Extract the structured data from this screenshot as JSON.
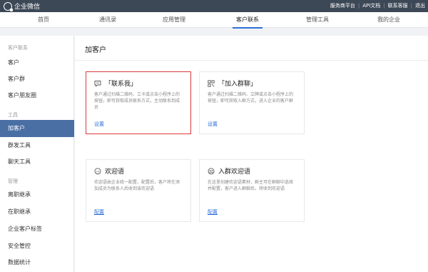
{
  "topbar": {
    "app_name": "企业微信",
    "links": [
      "服务商平台",
      "API文档",
      "联系客服",
      "退出"
    ]
  },
  "nav": {
    "items": [
      {
        "label": "首页"
      },
      {
        "label": "通讯录"
      },
      {
        "label": "应用管理"
      },
      {
        "label": "客户联系",
        "active": true
      },
      {
        "label": "管理工具"
      },
      {
        "label": "我的企业"
      }
    ]
  },
  "sidebar": {
    "groups": [
      {
        "label": "客户联系",
        "items": [
          "客户",
          "客户群",
          "客户朋友圈"
        ]
      },
      {
        "label": "工具",
        "items": [
          "加客户",
          "群发工具",
          "聊天工具"
        ]
      },
      {
        "label": "管理",
        "items": [
          "离职继承",
          "在职继承",
          "企业客户标签",
          "安全管控",
          "数据统计"
        ]
      }
    ],
    "active_item": "加客户"
  },
  "main": {
    "title": "加客户",
    "cards": [
      {
        "icon": "chat-bubble-icon",
        "title": "「联系我」",
        "desc": "客户通过扫描二维码、工卡或点击小程序上的按钮，即可获取成员联系方式，主动联系到成员",
        "link": "设置"
      },
      {
        "icon": "qr-code-icon",
        "title": "「加入群聊」",
        "desc": "客户通过扫描二维码、立牌或点击小程序上的按钮，即可获取入群方式，进入企业的客户群",
        "link": "设置"
      },
      {
        "icon": "hi-bubble-icon",
        "title": "欢迎语",
        "desc": "欢迎语由企业统一配置，配置后，客户将在添加成员为联系人后收到该欢迎语",
        "link": "配置"
      },
      {
        "icon": "group-chat-icon",
        "title": "入群欢迎语",
        "desc": "在这里创建欢迎语素材，群主可在群聊中选择并配置，客户进入群聊后，将收到欢迎语",
        "link": "配置"
      }
    ]
  },
  "colors": {
    "topbar": "#3d4857",
    "accent": "#2e6ed6",
    "sidebar_active": "#4a6fa5",
    "highlight_border": "#d83a3a"
  }
}
